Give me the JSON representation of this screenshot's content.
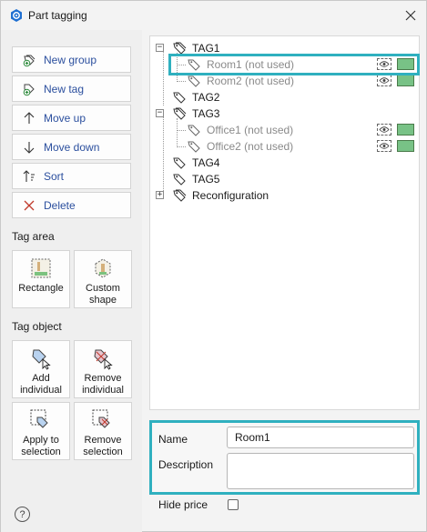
{
  "window": {
    "title": "Part tagging",
    "close_icon": "close-icon",
    "accent": "#2fb0bf",
    "swatch_color": "#78c286"
  },
  "toolbar": {
    "new_group": "New group",
    "new_tag": "New tag",
    "move_up": "Move up",
    "move_down": "Move down",
    "sort": "Sort",
    "delete": "Delete"
  },
  "tag_area": {
    "heading": "Tag area",
    "rectangle": "Rectangle",
    "custom_shape_1": "Custom",
    "custom_shape_2": "shape"
  },
  "tag_object": {
    "heading": "Tag object",
    "add_individual_1": "Add",
    "add_individual_2": "individual",
    "remove_individual_1": "Remove",
    "remove_individual_2": "individual",
    "apply_selection_1": "Apply to",
    "apply_selection_2": "selection",
    "remove_selection_1": "Remove",
    "remove_selection_2": "selection"
  },
  "help": {
    "label": "?"
  },
  "tree": {
    "tag1": "TAG1",
    "room1": "Room1 (not used)",
    "room2": "Room2 (not used)",
    "tag2": "TAG2",
    "tag3": "TAG3",
    "office1": "Office1 (not used)",
    "office2": "Office2 (not used)",
    "tag4": "TAG4",
    "tag5": "TAG5",
    "reconfiguration": "Reconfiguration",
    "expanded_sign": "−",
    "collapsed_sign": "+"
  },
  "properties": {
    "name_label": "Name",
    "name_value": "Room1",
    "description_label": "Description",
    "description_value": "",
    "hide_price_label": "Hide price",
    "hide_price_checked": false
  }
}
